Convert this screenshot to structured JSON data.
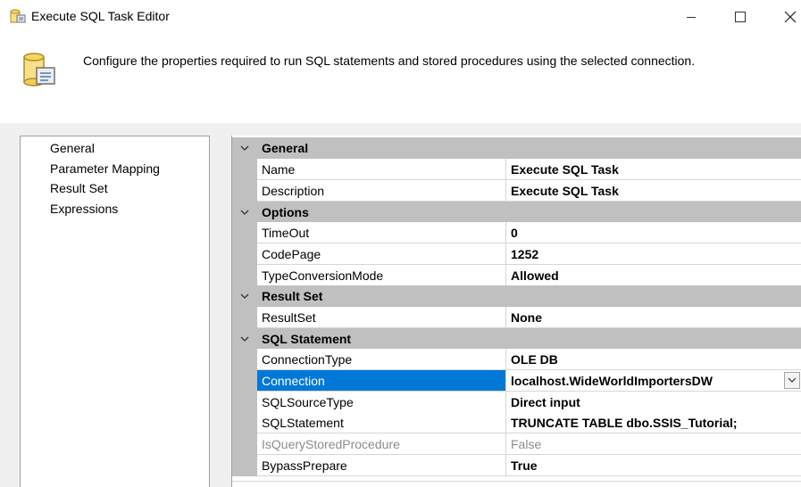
{
  "window": {
    "title": "Execute SQL Task Editor"
  },
  "header": {
    "description": "Configure the properties required to run SQL statements and stored procedures using the selected connection."
  },
  "nav": {
    "items": [
      {
        "label": "General"
      },
      {
        "label": "Parameter Mapping"
      },
      {
        "label": "Result Set"
      },
      {
        "label": "Expressions"
      }
    ]
  },
  "grid": {
    "categories": {
      "general": "General",
      "options": "Options",
      "result_set": "Result Set",
      "sql_statement": "SQL Statement"
    },
    "rows": {
      "name": {
        "label": "Name",
        "value": "Execute SQL Task"
      },
      "description": {
        "label": "Description",
        "value": "Execute SQL Task"
      },
      "timeout": {
        "label": "TimeOut",
        "value": "0"
      },
      "codepage": {
        "label": "CodePage",
        "value": "1252"
      },
      "typeconversion": {
        "label": "TypeConversionMode",
        "value": "Allowed"
      },
      "resultset": {
        "label": "ResultSet",
        "value": "None"
      },
      "connectiontype": {
        "label": "ConnectionType",
        "value": "OLE DB"
      },
      "connection": {
        "label": "Connection",
        "value": "localhost.WideWorldImportersDW"
      },
      "sqlsourcetype": {
        "label": "SQLSourceType",
        "value": "Direct input"
      },
      "sqlstatement": {
        "label": "SQLStatement",
        "value": "TRUNCATE TABLE dbo.SSIS_Tutorial;"
      },
      "isquerystored": {
        "label": "IsQueryStoredProcedure",
        "value": "False"
      },
      "bypassprepare": {
        "label": "BypassPrepare",
        "value": "True"
      }
    }
  },
  "colors": {
    "selection": "#0078d7",
    "category_bg": "#c0c0c0",
    "disabled_text": "#8c8c8c"
  }
}
